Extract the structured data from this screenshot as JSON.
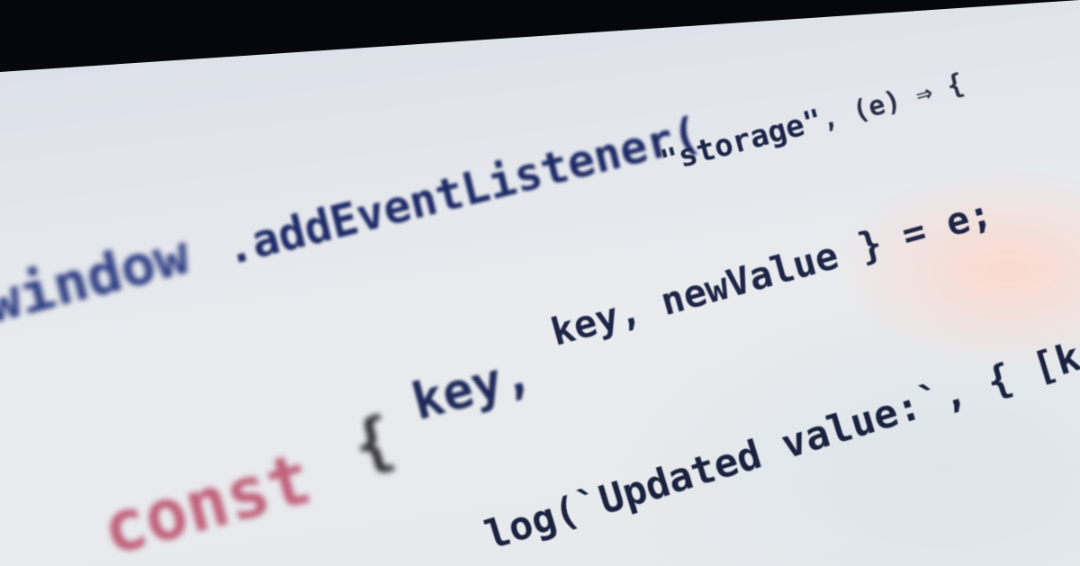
{
  "photo": {
    "subject": "code-on-monitor"
  },
  "code": {
    "line1": {
      "object": "window",
      "method": ".addEventListener(",
      "event_string": "\"storage\"",
      "params": ", (e) ⇒ {"
    },
    "line2": {
      "text": "key, newValue } = e;"
    },
    "line3": {
      "keyword": "const",
      "brace": "{",
      "ident": "key,"
    },
    "line4": {
      "call": "log(`Updated value:`, { [key]: newValue });"
    }
  },
  "colors": {
    "keyword": "#c0607a",
    "identifier": "#23305e",
    "screen": "#e6e9ec",
    "bezel": "#05070d"
  }
}
